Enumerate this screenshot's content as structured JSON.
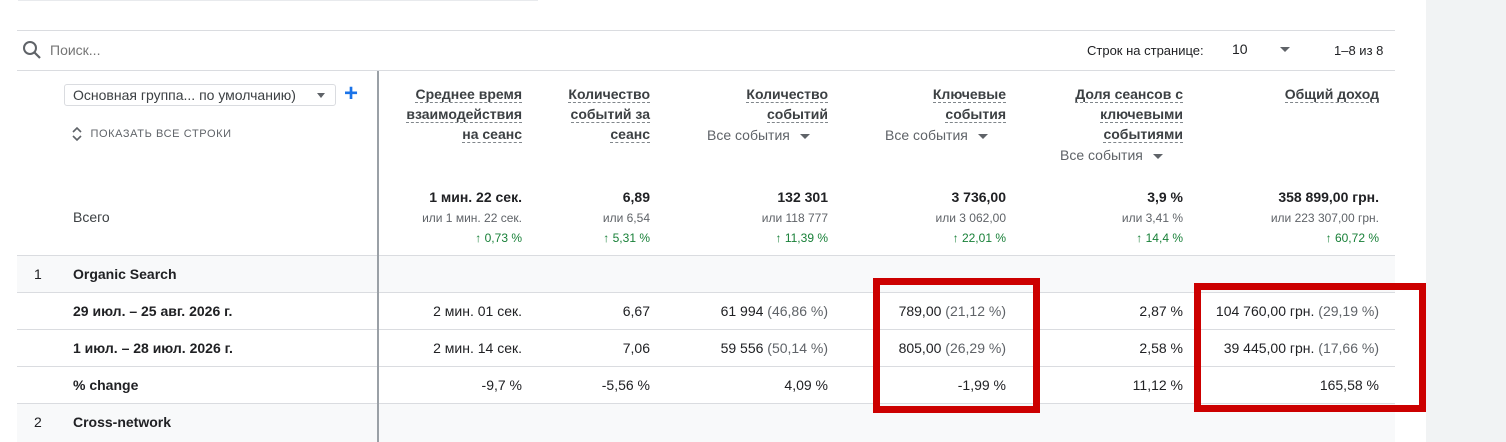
{
  "toolbar": {
    "search_placeholder": "Поиск...",
    "rows_per_page_label": "Строк на странице:",
    "rows_per_page_value": "10",
    "pagination": "1–8 из 8"
  },
  "dimension": {
    "selector_label": "Основная группа... по умолчанию)",
    "show_all_rows": "ПОКАЗАТЬ ВСЕ СТРОКИ",
    "total_label": "Всего"
  },
  "columns": [
    {
      "title_lines": [
        "Среднее время",
        "взаимодействия",
        "на сеанс"
      ],
      "filter": "",
      "total": "1 мин. 22 сек.",
      "compare": "или 1 мин. 22 сек.",
      "change": "↑ 0,73 %"
    },
    {
      "title_lines": [
        "Количество",
        "событий за",
        "сеанс"
      ],
      "filter": "",
      "total": "6,89",
      "compare": "или 6,54",
      "change": "↑ 5,31 %"
    },
    {
      "title_lines": [
        "Количество",
        "событий"
      ],
      "filter": "Все события",
      "total": "132 301",
      "compare": "или 118 777",
      "change": "↑ 11,39 %"
    },
    {
      "title_lines": [
        "Ключевые",
        "события"
      ],
      "filter": "Все события",
      "total": "3 736,00",
      "compare": "или 3 062,00",
      "change": "↑ 22,01 %"
    },
    {
      "title_lines": [
        "Доля сеансов с",
        "ключевыми",
        "событиями"
      ],
      "filter": "Все события",
      "total": "3,9 %",
      "compare": "или 3,41 %",
      "change": "↑ 14,4 %"
    },
    {
      "title_lines": [
        "Общий доход"
      ],
      "filter": "",
      "total": "358 899,00 грн.",
      "compare": "или 223 307,00 грн.",
      "change": "↑ 60,72 %"
    }
  ],
  "rows": [
    {
      "num": "1",
      "label": "Organic Search"
    },
    {
      "label": "29 июл. – 25 авг. 2026 г.",
      "cells": [
        {
          "v": "2 мин. 01 сек.",
          "p": ""
        },
        {
          "v": "6,67",
          "p": ""
        },
        {
          "v": "61 994",
          "p": "(46,86 %)"
        },
        {
          "v": "789,00",
          "p": "(21,12 %)"
        },
        {
          "v": "2,87 %",
          "p": ""
        },
        {
          "v": "104 760,00 грн.",
          "p": "(29,19 %)"
        }
      ]
    },
    {
      "label": "1 июл. – 28 июл. 2026 г.",
      "cells": [
        {
          "v": "2 мин. 14 сек.",
          "p": ""
        },
        {
          "v": "7,06",
          "p": ""
        },
        {
          "v": "59 556",
          "p": "(50,14 %)"
        },
        {
          "v": "805,00",
          "p": "(26,29 %)"
        },
        {
          "v": "2,58 %",
          "p": ""
        },
        {
          "v": "39 445,00 грн.",
          "p": "(17,66 %)"
        }
      ]
    },
    {
      "label": "% change",
      "cells": [
        {
          "v": "-9,7 %",
          "p": ""
        },
        {
          "v": "-5,56 %",
          "p": ""
        },
        {
          "v": "4,09 %",
          "p": ""
        },
        {
          "v": "-1,99 %",
          "p": ""
        },
        {
          "v": "11,12 %",
          "p": ""
        },
        {
          "v": "165,58 %",
          "p": ""
        }
      ]
    },
    {
      "num": "2",
      "label": "Cross-network"
    }
  ],
  "colors": {
    "highlight": "#cc0000",
    "positive": "#188038",
    "accent": "#1a73e8"
  }
}
